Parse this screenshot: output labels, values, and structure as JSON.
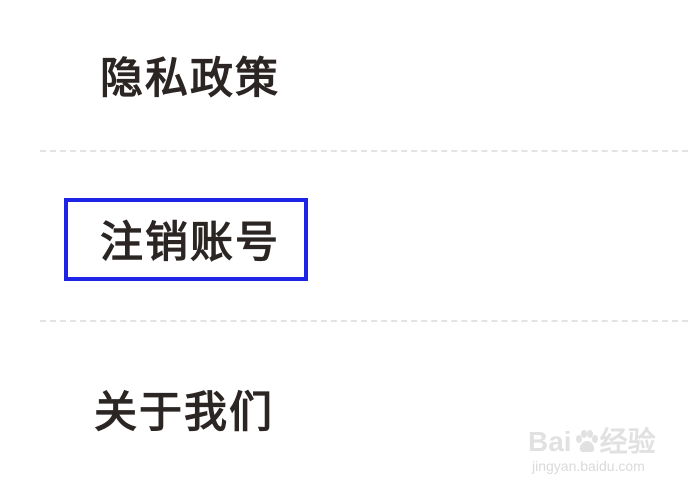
{
  "menu": {
    "items": [
      {
        "label": "隐私政策"
      },
      {
        "label": "注销账号"
      },
      {
        "label": "关于我们"
      }
    ]
  },
  "watermark": {
    "brand_left": "Bai",
    "brand_right": "经验",
    "url": "jingyan.baidu.com"
  },
  "colors": {
    "text": "#2b2623",
    "highlight_border": "#1e24e6",
    "divider": "#e3e3e3"
  },
  "icons": [
    "baidu-paw-icon"
  ]
}
